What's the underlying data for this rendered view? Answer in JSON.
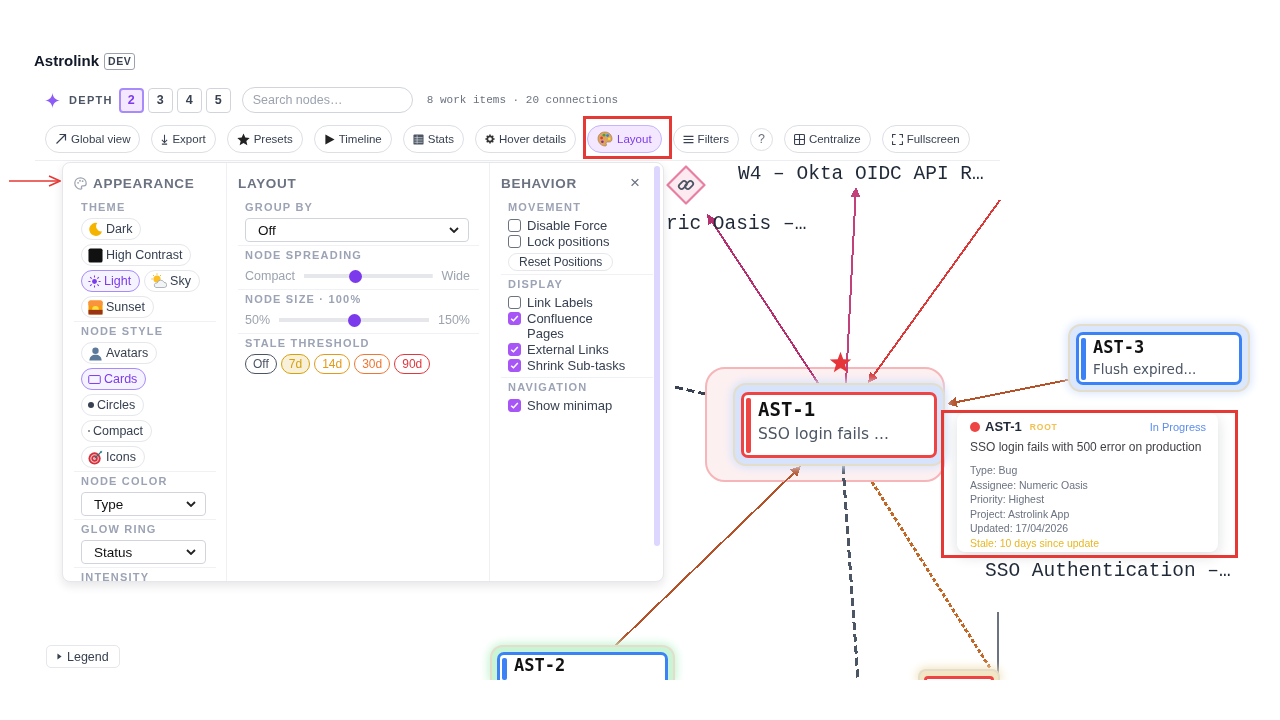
{
  "app": {
    "title": "Astrolink",
    "badge": "DEV"
  },
  "depth": {
    "label": "DEPTH",
    "options": [
      {
        "label": "2",
        "selected": true
      },
      {
        "label": "3",
        "selected": false
      },
      {
        "label": "4",
        "selected": false
      },
      {
        "label": "5",
        "selected": false
      }
    ]
  },
  "search": {
    "placeholder": "Search nodes…"
  },
  "summary": "8 work items · 20 connections",
  "toolbar": [
    {
      "label": "Global view",
      "kind": "pill",
      "selected": false
    },
    {
      "label": "Export",
      "kind": "pill",
      "selected": false
    },
    {
      "label": "Presets",
      "kind": "pill",
      "selected": false
    },
    {
      "label": "Timeline",
      "kind": "pill",
      "selected": false
    },
    {
      "label": "Stats",
      "kind": "pill",
      "selected": false
    },
    {
      "label": "Hover details",
      "kind": "pill",
      "selected": false
    },
    {
      "label": "Layout",
      "kind": "pill",
      "selected": true
    },
    {
      "label": "Filters",
      "kind": "pill",
      "selected": false
    },
    {
      "label": "?",
      "kind": "round",
      "selected": false
    },
    {
      "label": "Centralize",
      "kind": "pill",
      "selected": false
    },
    {
      "label": "Fullscreen",
      "kind": "pill",
      "selected": false
    }
  ],
  "panel": {
    "close": "×",
    "columns": [
      {
        "title": "APPEARANCE",
        "groups": [
          {
            "label": "THEME",
            "kind": "chips",
            "options": [
              {
                "label": "Dark",
                "selected": false
              },
              {
                "label": "High Contrast",
                "selected": false
              },
              {
                "label": "Light",
                "selected": true
              },
              {
                "label": "Sky",
                "selected": false
              },
              {
                "label": "Sunset",
                "selected": false
              }
            ]
          },
          {
            "label": "NODE STYLE",
            "kind": "chips",
            "options": [
              {
                "label": "Avatars",
                "selected": false
              },
              {
                "label": "Cards",
                "selected": true
              },
              {
                "label": "Circles",
                "selected": false
              },
              {
                "label": "Compact",
                "selected": false
              },
              {
                "label": "Icons",
                "selected": false
              }
            ]
          },
          {
            "label": "NODE COLOR",
            "kind": "select",
            "value": "Type"
          },
          {
            "label": "GLOW RING",
            "kind": "select",
            "value": "Status"
          },
          {
            "label": "INTENSITY",
            "kind": "heading"
          }
        ]
      },
      {
        "title": "LAYOUT",
        "groups": [
          {
            "label": "GROUP BY",
            "kind": "select",
            "value": "Off"
          },
          {
            "label": "NODE SPREADING",
            "kind": "slider",
            "min_label": "Compact",
            "max_label": "Wide",
            "level": 0.4
          },
          {
            "label": "NODE SIZE · 100%",
            "kind": "slider",
            "min_label": "50%",
            "max_label": "150%",
            "level": 0.5
          },
          {
            "label": "STALE THRESHOLD",
            "kind": "chips",
            "options": [
              {
                "label": "Off",
                "selected": false,
                "color": "#4b5563"
              },
              {
                "label": "7d",
                "selected": true,
                "color": "#d4a20c"
              },
              {
                "label": "14d",
                "selected": false,
                "color": "#e39a1b"
              },
              {
                "label": "30d",
                "selected": false,
                "color": "#ee7733"
              },
              {
                "label": "90d",
                "selected": false,
                "color": "#e0383e"
              }
            ]
          }
        ]
      },
      {
        "title": "BEHAVIOR",
        "groups": [
          {
            "label": "MOVEMENT",
            "kind": "checks",
            "items": [
              {
                "label": "Disable Force",
                "checked": false
              },
              {
                "label": "Lock positions",
                "checked": false
              }
            ],
            "button": "Reset Positions"
          },
          {
            "label": "DISPLAY",
            "kind": "checks",
            "items": [
              {
                "label": "Link Labels",
                "checked": false
              },
              {
                "label": "Confluence Pages",
                "checked": true
              },
              {
                "label": "External Links",
                "checked": true
              },
              {
                "label": "Shrink Sub-tasks",
                "checked": true
              }
            ]
          },
          {
            "label": "NAVIGATION",
            "kind": "checks",
            "items": [
              {
                "label": "Show minimap",
                "checked": true
              }
            ]
          }
        ]
      }
    ]
  },
  "graph": {
    "nodes": [
      {
        "kind": "diamond"
      },
      {
        "kind": "label",
        "text": "W4 – Okta OIDC API R…"
      },
      {
        "kind": "label",
        "text": "ric Oasis –…"
      },
      {
        "kind": "card",
        "key": "AST-1",
        "summary": "SSO login fails ...",
        "color": "#ef4444",
        "ring": {
          "color": "#d6e3fb"
        },
        "root": true
      },
      {
        "kind": "card",
        "key": "AST-3",
        "summary": "Flush expired...",
        "color": "#3b82f6",
        "ring": {
          "color": "#dbe7fd"
        },
        "root": false
      },
      {
        "kind": "label",
        "text": "SSO Authentication –…"
      },
      {
        "kind": "card",
        "key": "AST-2",
        "color": "#3b82f6",
        "ring": {
          "color": "#c9f5d6"
        },
        "root": false
      },
      {
        "kind": "card",
        "color": "#ef4444",
        "ring": {
          "color": "#f3e6c4"
        },
        "root": false
      }
    ],
    "edges": [
      {
        "kind": "arrow",
        "color": "#b5306e"
      },
      {
        "kind": "arrow",
        "color": "#c2417a"
      },
      {
        "kind": "arrow",
        "color": "#d93a3a"
      },
      {
        "kind": "arrow",
        "color": "#b4532a"
      },
      {
        "kind": "dashed",
        "color": "#374151"
      },
      {
        "kind": "dashed",
        "color": "#4b5563"
      },
      {
        "kind": "dotted",
        "color": "#c2692a"
      },
      {
        "kind": "arrow",
        "color": "#b4532a"
      }
    ]
  },
  "tooltip": {
    "color": "#ef4444",
    "key": "AST-1",
    "badge": "ROOT",
    "status": "In Progress",
    "title": "SSO login fails with 500 error on production",
    "details": [
      "Type: Bug",
      "Assignee: Numeric Oasis",
      "Priority: Highest",
      "Project: Astrolink App",
      "Updated: 17/04/2026"
    ],
    "stale": "Stale: 10 days since update"
  },
  "legend": {
    "label": "Legend",
    "expanded": false
  }
}
